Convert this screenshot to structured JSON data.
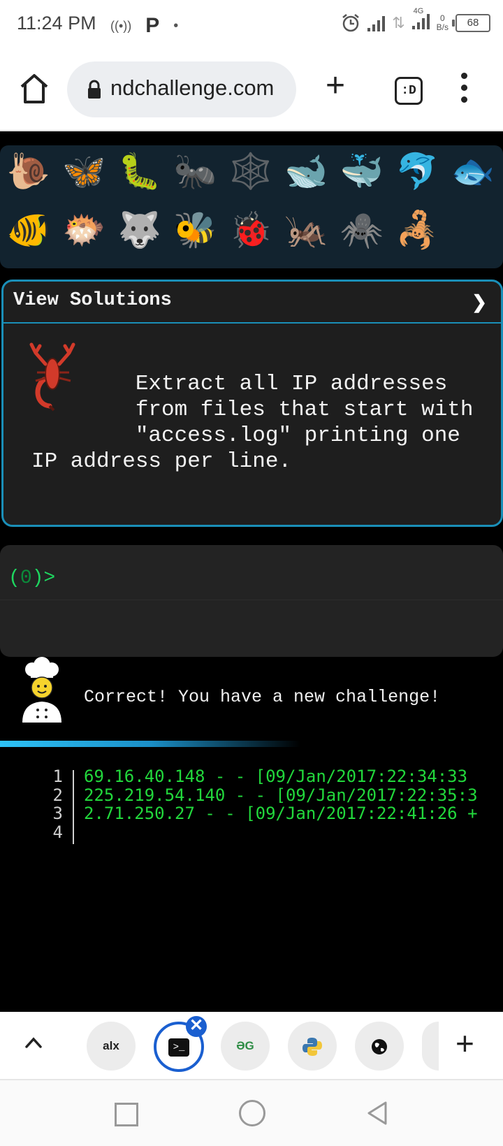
{
  "status_bar": {
    "time": "11:24 PM",
    "network_type": "4G",
    "net_speed_value": "0",
    "net_speed_unit": "B/s",
    "battery": "68",
    "icons": [
      "hotspot-icon",
      "p-app-icon",
      "dot-icon",
      "alarm-icon",
      "signal-icon",
      "data-arrows-icon",
      "signal-4g-icon",
      "battery-icon"
    ]
  },
  "browser": {
    "url": "ndchallenge.com",
    "tabs_label": ":D"
  },
  "animals": [
    "🐌",
    "🦋",
    "🐛",
    "🐜",
    "🕸️",
    "🐋",
    "🐳",
    "🐬",
    "🐟",
    "🐠",
    "🐡",
    "🐺",
    "🐝",
    "🐞",
    "🦗",
    "🕷️",
    "🦂"
  ],
  "card": {
    "title": "View Solutions",
    "chevron": "❯",
    "text": "        Extract all IP addresses\n        from files that start with\n        \"access.log\" printing one\nIP address per line."
  },
  "terminal": {
    "prompt_open": "(",
    "prompt_zero": "0",
    "prompt_close": ")>"
  },
  "feedback": {
    "message": "Correct! You have a new challenge!"
  },
  "output": {
    "line_numbers": [
      "1",
      "2",
      "3",
      "4"
    ],
    "lines": [
      "69.16.40.148 - - [09/Jan/2017:22:34:33",
      "225.219.54.140 - - [09/Jan/2017:22:35:3",
      "2.71.250.27 - - [09/Jan/2017:22:41:26 +",
      ""
    ]
  },
  "tab_strip": {
    "tabs": [
      {
        "name": "alx-tab",
        "label": "alx"
      },
      {
        "name": "terminal-tab",
        "label": ">_"
      },
      {
        "name": "gfg-tab",
        "label": "ƏG"
      },
      {
        "name": "python-tab",
        "label": ""
      },
      {
        "name": "globe-tab",
        "label": ""
      }
    ],
    "close_label": "✕",
    "add_label": "+"
  },
  "colors": {
    "accent": "#1a8fb8",
    "terminal_green": "#22d83c",
    "active_tab": "#1a5fd0"
  }
}
